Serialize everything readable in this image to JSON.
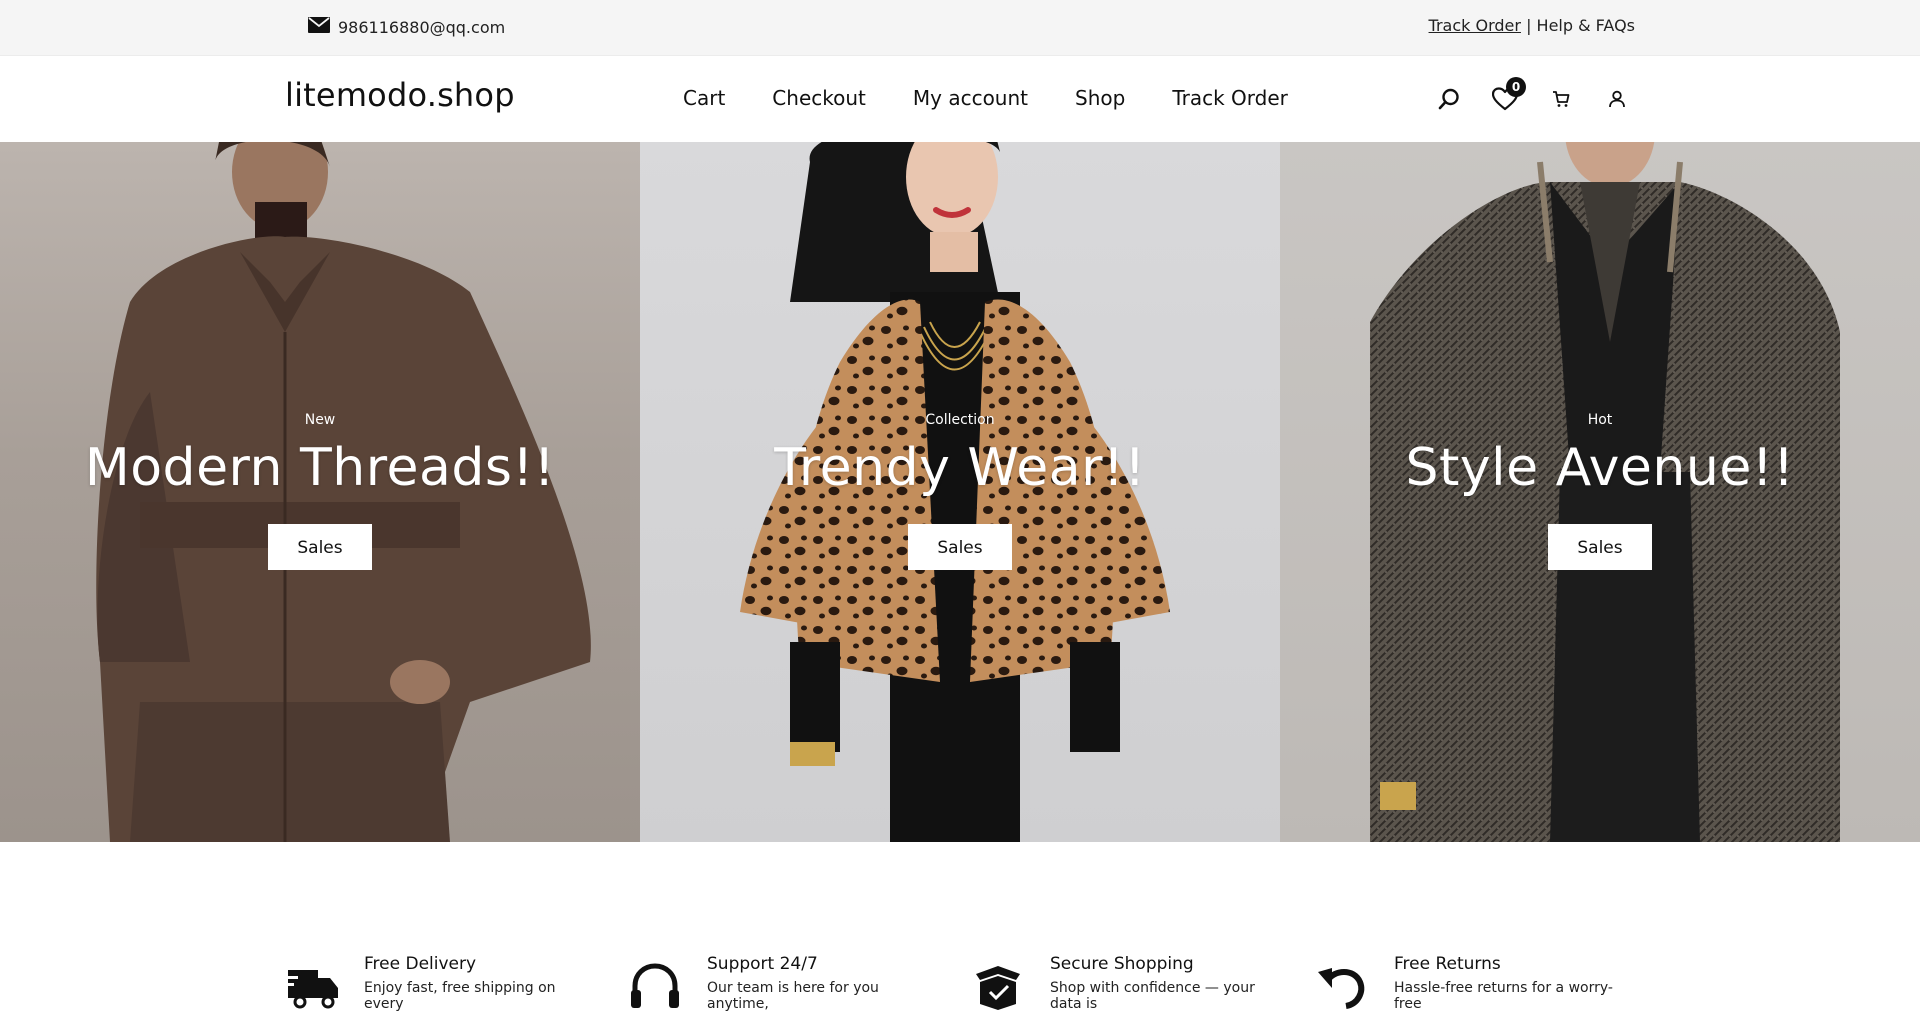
{
  "topbar": {
    "email": "986116880@qq.com",
    "track_order": "Track Order",
    "separator": "|",
    "help": "Help & FAQs"
  },
  "header": {
    "logo": "litemodo.shop",
    "nav": [
      "Cart",
      "Checkout",
      "My account",
      "Shop",
      "Track Order"
    ],
    "wishlist_count": "0",
    "icons": [
      "search-icon",
      "heart-icon",
      "cart-icon",
      "user-icon"
    ]
  },
  "hero": {
    "slides": [
      {
        "kicker": "New",
        "headline": "Modern Threads!!",
        "cta": "Sales"
      },
      {
        "kicker": "Collection",
        "headline": "Trendy Wear!!",
        "cta": "Sales"
      },
      {
        "kicker": "Hot",
        "headline": "Style Avenue!!",
        "cta": "Sales"
      }
    ]
  },
  "features": [
    {
      "icon": "delivery-truck-icon",
      "title": "Free Delivery",
      "desc": "Enjoy fast, free shipping on every"
    },
    {
      "icon": "headphones-icon",
      "title": "Support 24/7",
      "desc": "Our team is here for you anytime,"
    },
    {
      "icon": "secure-box-icon",
      "title": "Secure Shopping",
      "desc": "Shop with confidence — your data is"
    },
    {
      "icon": "return-arrow-icon",
      "title": "Free Returns",
      "desc": "Hassle-free returns for a worry-free"
    }
  ],
  "colors": {
    "topbar_bg": "#f5f5f5",
    "text": "#111111",
    "button_bg": "#ffffff"
  }
}
